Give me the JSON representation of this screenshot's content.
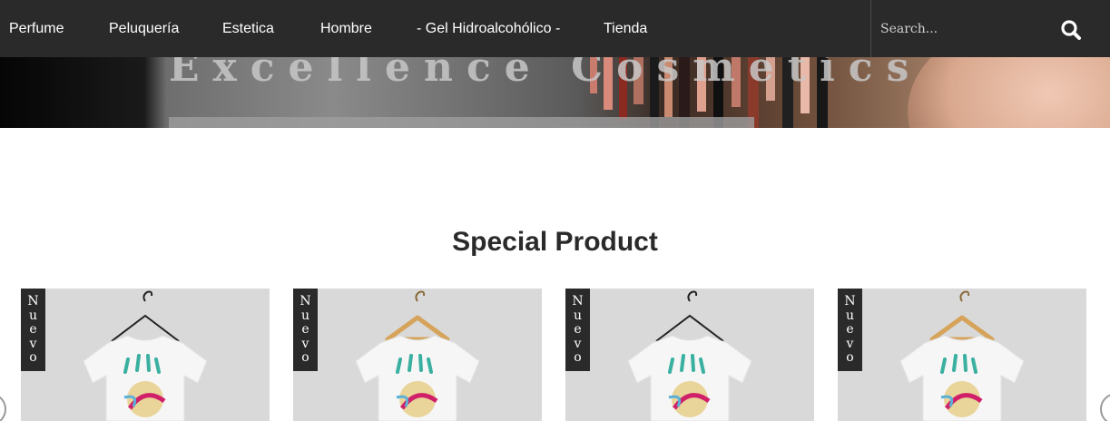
{
  "nav": {
    "items": [
      {
        "label": "Perfume"
      },
      {
        "label": "Peluquería"
      },
      {
        "label": "Estetica"
      },
      {
        "label": "Hombre"
      },
      {
        "label": "- Gel Hidroalcohólico -"
      },
      {
        "label": "Tienda"
      }
    ],
    "search": {
      "placeholder": "Search...",
      "icon": "search-icon"
    }
  },
  "banner": {
    "text": "Excellence Cosmetics"
  },
  "section": {
    "title": "Special Product"
  },
  "products": [
    {
      "badge": "N\nu\ne\nv\no",
      "hanger": "black"
    },
    {
      "badge": "N\nu\ne\nv\no",
      "hanger": "wood"
    },
    {
      "badge": "N\nu\ne\nv\no",
      "hanger": "black"
    },
    {
      "badge": "N\nu\ne\nv\no",
      "hanger": "wood"
    }
  ],
  "carousel": {
    "prev_icon": "chevron-left-icon",
    "next_icon": "chevron-right-icon"
  },
  "colors": {
    "nav_bg": "#2a2a2a",
    "badge_bg": "#2a2a2a",
    "card_bg": "#d9d9d9",
    "title": "#2a2a2a"
  }
}
